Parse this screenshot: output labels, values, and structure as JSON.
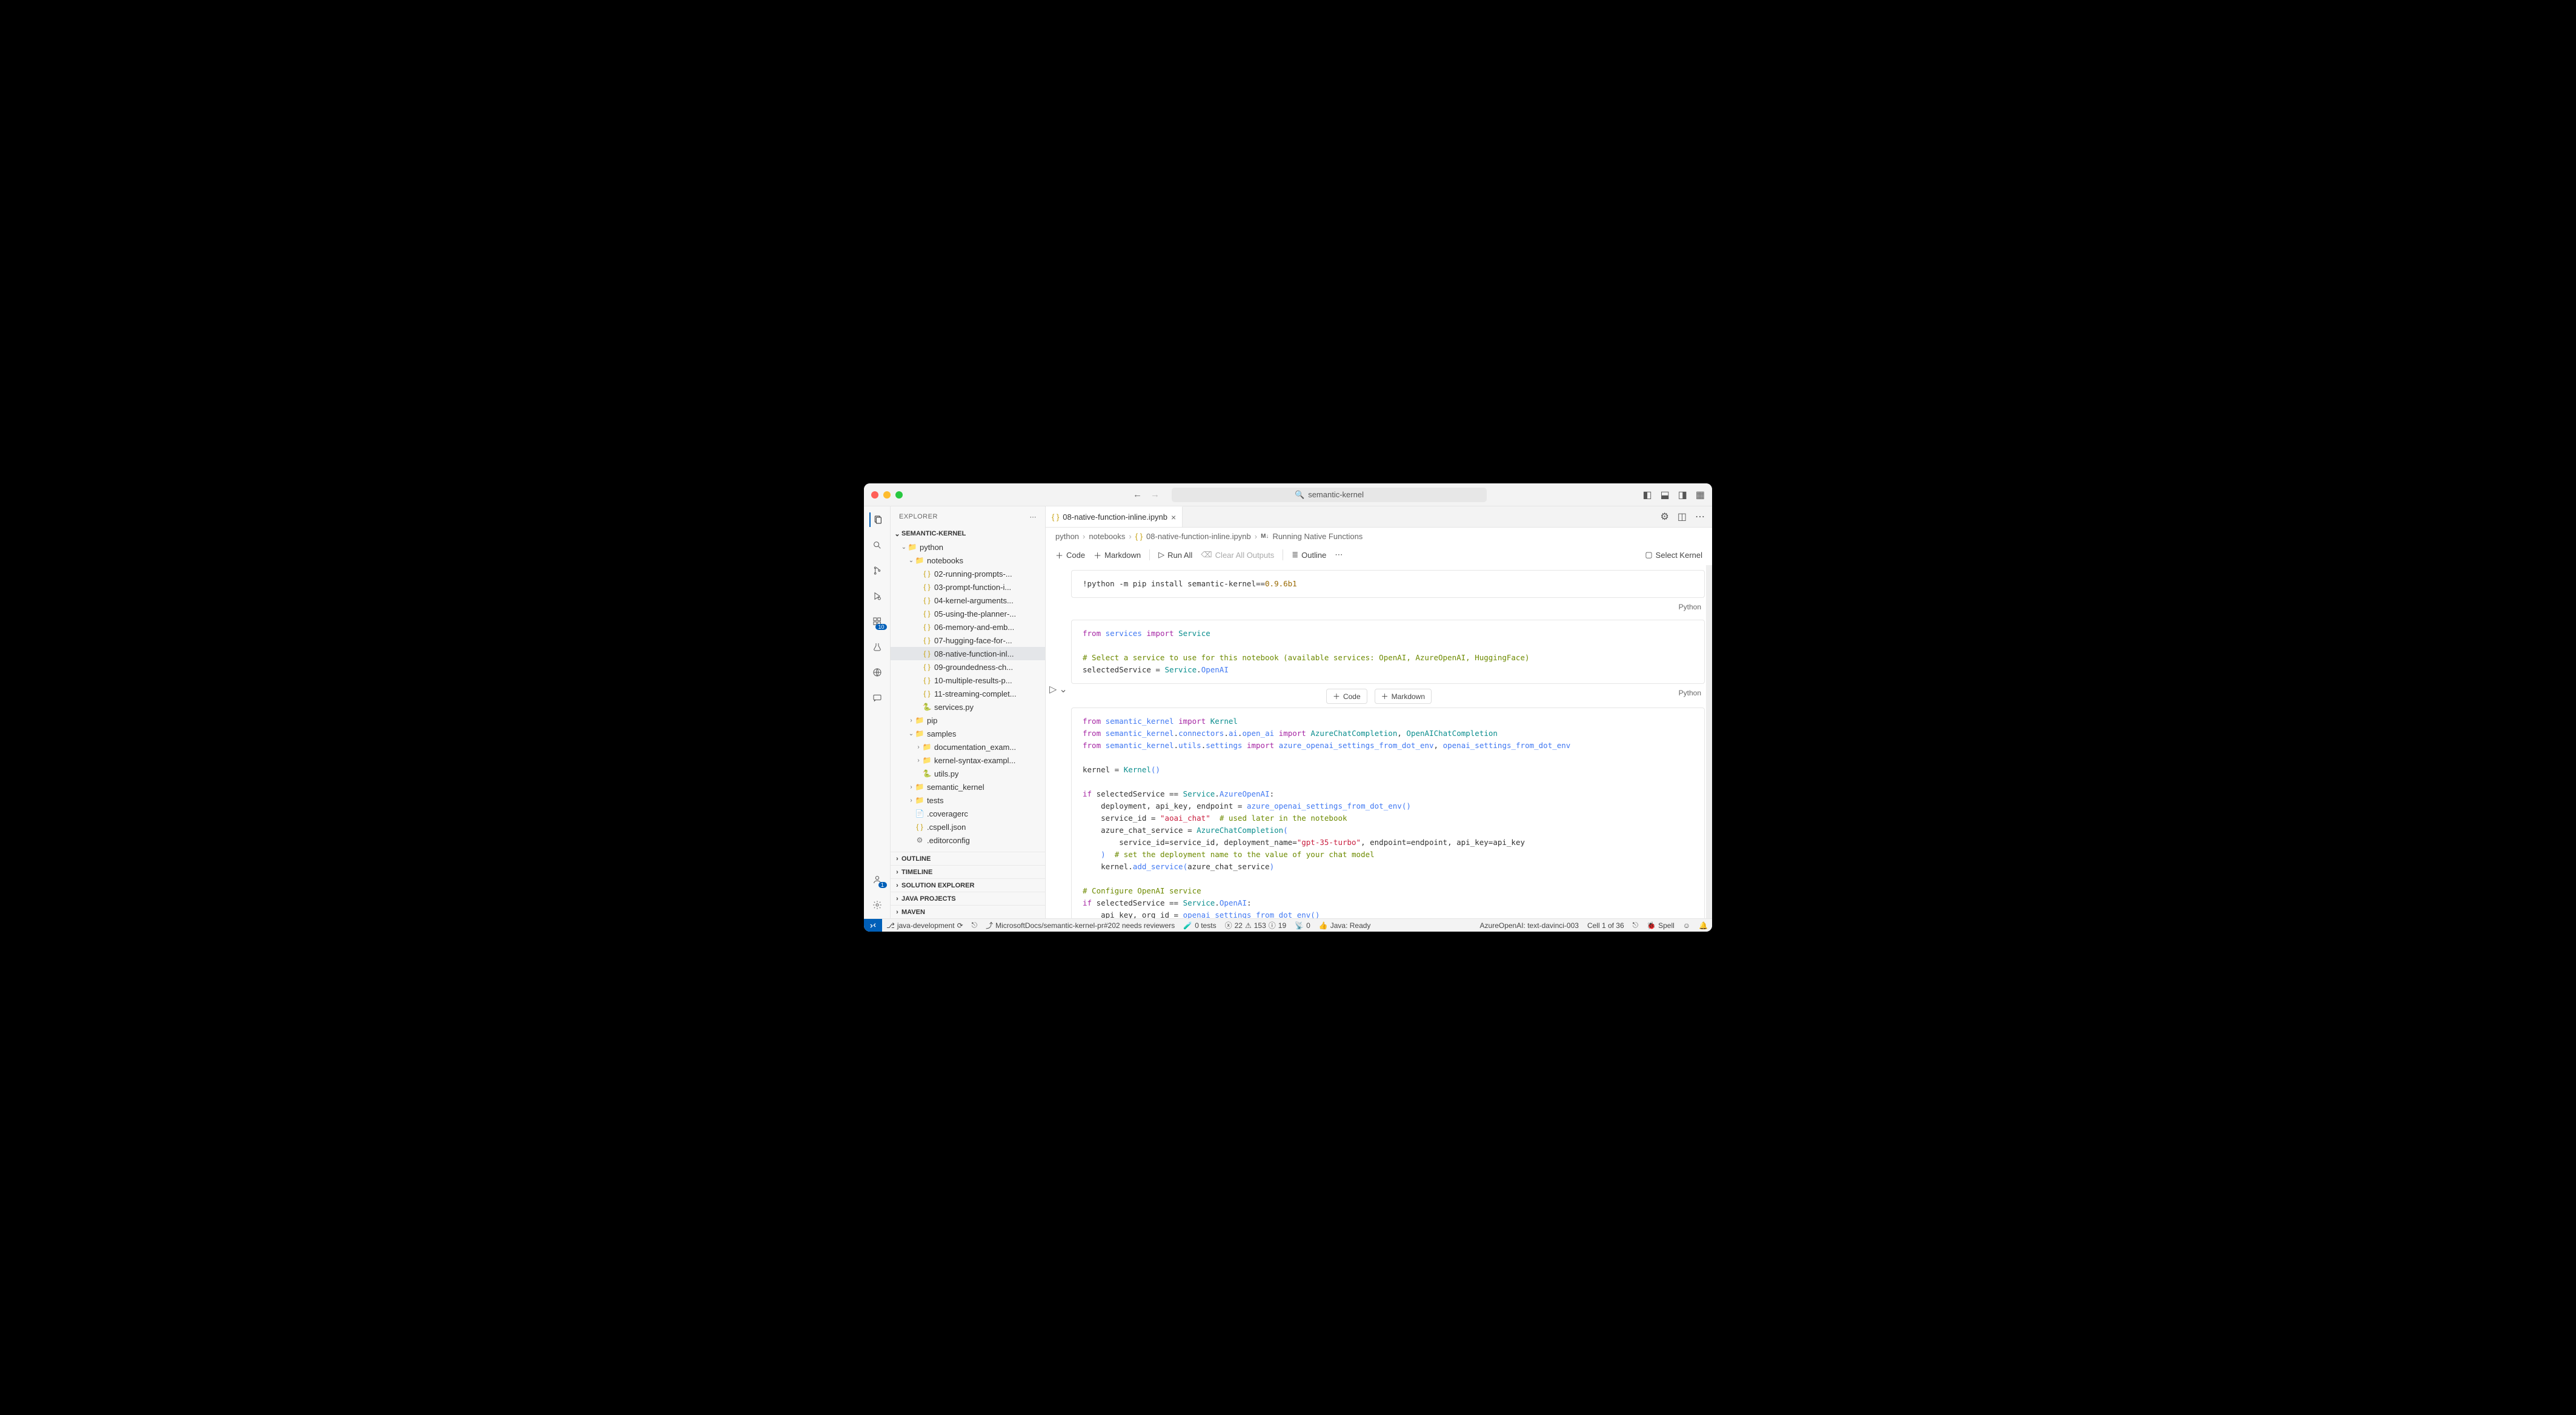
{
  "titlebar": {
    "search_text": "semantic-kernel"
  },
  "explorer": {
    "title": "EXPLORER",
    "root": "SEMANTIC-KERNEL",
    "items": [
      {
        "type": "folder",
        "label": "python",
        "depth": 1,
        "open": true
      },
      {
        "type": "folder",
        "label": "notebooks",
        "depth": 2,
        "open": true
      },
      {
        "type": "json",
        "label": "02-running-prompts-...",
        "depth": 3
      },
      {
        "type": "json",
        "label": "03-prompt-function-i...",
        "depth": 3
      },
      {
        "type": "json",
        "label": "04-kernel-arguments...",
        "depth": 3
      },
      {
        "type": "json",
        "label": "05-using-the-planner-...",
        "depth": 3
      },
      {
        "type": "json",
        "label": "06-memory-and-emb...",
        "depth": 3
      },
      {
        "type": "json",
        "label": "07-hugging-face-for-...",
        "depth": 3
      },
      {
        "type": "json",
        "label": "08-native-function-inl...",
        "depth": 3,
        "selected": true
      },
      {
        "type": "json",
        "label": "09-groundedness-ch...",
        "depth": 3
      },
      {
        "type": "json",
        "label": "10-multiple-results-p...",
        "depth": 3
      },
      {
        "type": "json",
        "label": "11-streaming-complet...",
        "depth": 3
      },
      {
        "type": "py",
        "label": "services.py",
        "depth": 3
      },
      {
        "type": "folder",
        "label": "pip",
        "depth": 2,
        "open": false
      },
      {
        "type": "folder",
        "label": "samples",
        "depth": 2,
        "open": true
      },
      {
        "type": "folder",
        "label": "documentation_exam...",
        "depth": 3,
        "open": false
      },
      {
        "type": "folder",
        "label": "kernel-syntax-exampl...",
        "depth": 3,
        "open": false
      },
      {
        "type": "py",
        "label": "utils.py",
        "depth": 3
      },
      {
        "type": "folder",
        "label": "semantic_kernel",
        "depth": 2,
        "open": false
      },
      {
        "type": "folder",
        "label": "tests",
        "depth": 2,
        "open": false
      },
      {
        "type": "file",
        "label": ".coveragerc",
        "depth": 2
      },
      {
        "type": "json",
        "label": ".cspell.json",
        "depth": 2
      },
      {
        "type": "file",
        "label": ".editorconfig",
        "depth": 2,
        "icon": "⚙"
      }
    ],
    "footer_sections": [
      "OUTLINE",
      "TIMELINE",
      "SOLUTION EXPLORER",
      "JAVA PROJECTS",
      "MAVEN"
    ]
  },
  "tab": {
    "label": "08-native-function-inline.ipynb"
  },
  "breadcrumb": {
    "seg1": "python",
    "seg2": "notebooks",
    "seg3": "08-native-function-inline.ipynb",
    "seg4": "Running Native Functions"
  },
  "nb_toolbar": {
    "code": "Code",
    "markdown": "Markdown",
    "run_all": "Run All",
    "clear": "Clear All Outputs",
    "outline": "Outline",
    "select_kernel": "Select Kernel"
  },
  "insert": {
    "code": "Code",
    "markdown": "Markdown"
  },
  "cell_lang": "Python",
  "cells": {
    "c1_html": "<span class='op'>!python -m pip install semantic-kernel==</span><span class='num'>0.9.6b1</span>",
    "c2_html": "<span class='kw'>from</span> <span class='fn'>services</span> <span class='kw'>import</span> <span class='cls'>Service</span>\n\n<span class='cmt'># Select a service to use for this notebook (available services: OpenAI, AzureOpenAI, HuggingFace)</span>\n<span class='op'>selectedService = </span><span class='cls'>Service</span>.<span class='fn'>OpenAI</span>",
    "c3_html": "<span class='kw'>from</span> <span class='fn'>semantic_kernel</span> <span class='kw'>import</span> <span class='cls'>Kernel</span>\n<span class='kw'>from</span> <span class='fn'>semantic_kernel</span>.<span class='fn'>connectors</span>.<span class='fn'>ai</span>.<span class='fn'>open_ai</span> <span class='kw'>import</span> <span class='cls'>AzureChatCompletion</span>, <span class='cls'>OpenAIChatCompletion</span>\n<span class='kw'>from</span> <span class='fn'>semantic_kernel</span>.<span class='fn'>utils</span>.<span class='fn'>settings</span> <span class='kw'>import</span> <span class='fn'>azure_openai_settings_from_dot_env</span>, <span class='fn'>openai_settings_from_dot_env</span>\n\n<span class='op'>kernel = </span><span class='cls'>Kernel</span><span class='fn'>()</span>\n\n<span class='kw'>if</span> <span class='op'>selectedService == </span><span class='cls'>Service</span>.<span class='fn'>AzureOpenAI</span><span class='op'>:</span>\n    <span class='op'>deployment, api_key, endpoint = </span><span class='fn'>azure_openai_settings_from_dot_env</span><span class='fn'>()</span>\n    <span class='op'>service_id = </span><span class='str'>\"aoai_chat\"</span>  <span class='cmt'># used later in the notebook</span>\n    <span class='op'>azure_chat_service = </span><span class='cls'>AzureChatCompletion</span><span class='fn'>(</span>\n        <span class='op'>service_id=service_id, deployment_name=</span><span class='str'>\"gpt-35-turbo\"</span><span class='op'>, endpoint=endpoint, api_key=api_key</span>\n    <span class='fn'>)</span>  <span class='cmt'># set the deployment name to the value of your chat model</span>\n    <span class='op'>kernel.</span><span class='fn'>add_service</span><span class='fn'>(</span><span class='op'>azure_chat_service</span><span class='fn'>)</span>\n\n<span class='cmt'># Configure OpenAI service</span>\n<span class='kw'>if</span> <span class='op'>selectedService == </span><span class='cls'>Service</span>.<span class='fn'>OpenAI</span><span class='op'>:</span>\n    <span class='op'>api_key, org_id = </span><span class='fn'>openai_settings_from_dot_env</span><span class='fn'>()</span>\n    <span class='op'>service_id = </span><span class='str'>\"oai_chat\"</span>  <span class='cmt'># used later in the notebook</span>\n    <span class='op'>oai_chat_service = </span><span class='cls'>OpenAIChatCompletion</span><span class='fn'>(</span>"
  },
  "statusbar": {
    "left": {
      "branch": "java-development",
      "pr": "MicrosoftDocs/semantic-kernel-pr#202 needs reviewers",
      "tests": "0 tests",
      "err": "22",
      "warn": "153",
      "info": "19",
      "radio": "0",
      "java": "Java: Ready"
    },
    "right": {
      "model": "AzureOpenAI: text-davinci-003",
      "cell": "Cell 1 of 36",
      "spell": "Spell"
    }
  },
  "badges": {
    "ext": "10",
    "account": "1"
  }
}
